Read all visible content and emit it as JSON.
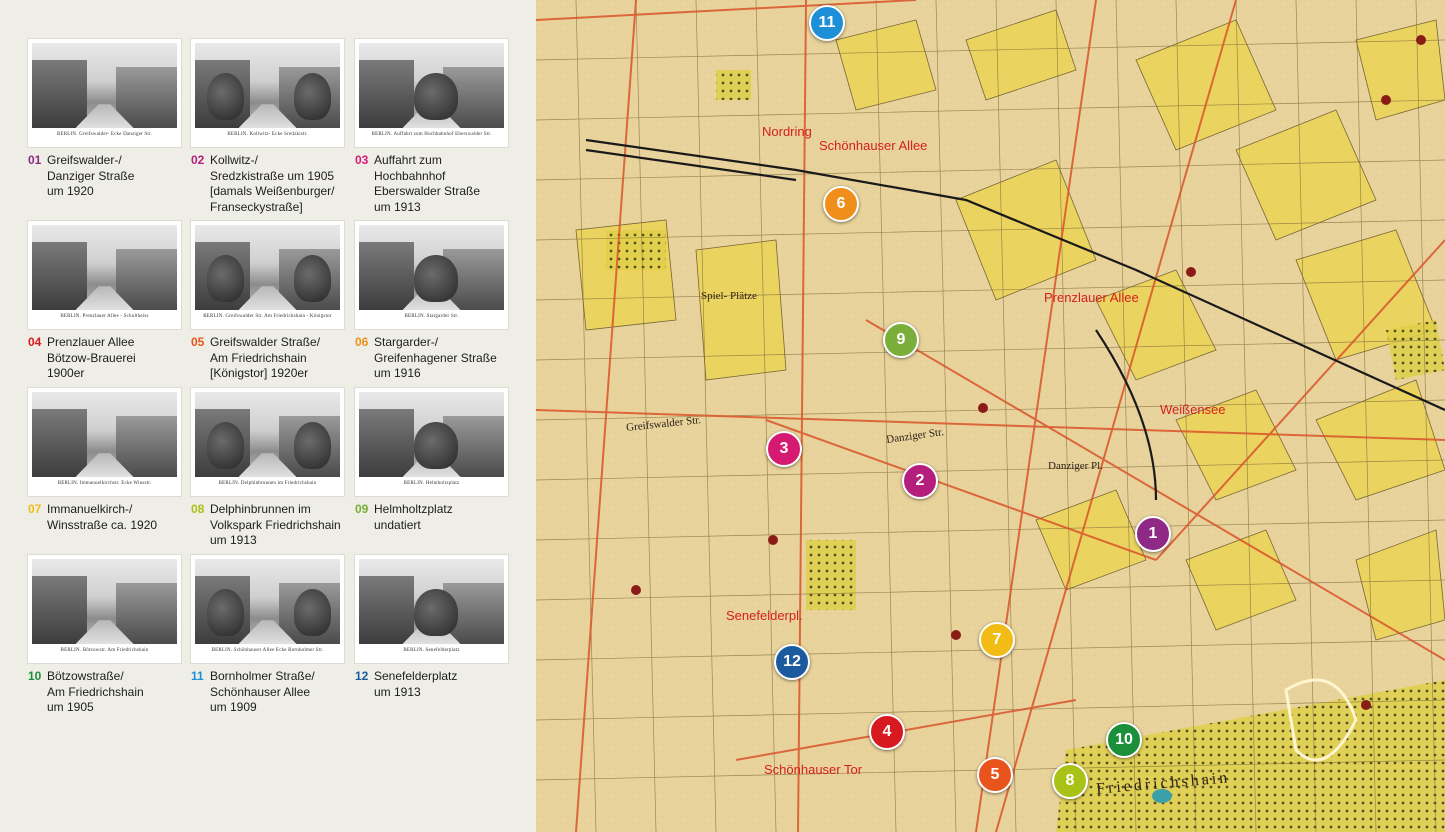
{
  "colors": {
    "c01": "#8e2a86",
    "c02": "#b41f7e",
    "c03": "#d61a72",
    "c04": "#d71920",
    "c05": "#e8541b",
    "c06": "#ef8e1a",
    "c07": "#f2bc14",
    "c08": "#a8c218",
    "c09": "#7aae3a",
    "c10": "#1c8f3a",
    "c11": "#1d8fd6",
    "c12": "#1c5aa0"
  },
  "photos": [
    {
      "num": "01",
      "color": "#8e2a86",
      "text": "Greifswalder-/\nDanziger Straße\num 1920",
      "caption": "BERLIN. Greifswalder- Ecke Danziger Str."
    },
    {
      "num": "02",
      "color": "#b41f7e",
      "text": "Kollwitz-/\nSredzkistraße um 1905\n[damals Weißenburger/\nFranseckystraße]",
      "caption": "BERLIN. Kollwitz- Ecke Sredzkistr."
    },
    {
      "num": "03",
      "color": "#d61a72",
      "text": "Auffahrt zum\nHochbahnhof\nEberswalder Straße\num 1913",
      "caption": "BERLIN. Auffahrt zum Hochbahnhof Eberswalder Str."
    },
    {
      "num": "04",
      "color": "#d71920",
      "text": "Prenzlauer Allee\nBötzow-Brauerei\n1900er",
      "caption": "BERLIN. Prenzlauer Allee - Schultheiss"
    },
    {
      "num": "05",
      "color": "#e8541b",
      "text": "Greifswalder Straße/\nAm Friedrichshain\n[Königstor] 1920er",
      "caption": "BERLIN. Greifswalder Str. Am Friedrichshain - Königstor"
    },
    {
      "num": "06",
      "color": "#ef8e1a",
      "text": "Stargarder-/\nGreifenhagener Straße\num 1916",
      "caption": "BERLIN. Stargarder Str."
    },
    {
      "num": "07",
      "color": "#f2bc14",
      "text": "Immanuelkirch-/\nWinsstraße ca. 1920",
      "caption": "BERLIN. Immanuelkirchstr. Ecke Winsstr."
    },
    {
      "num": "08",
      "color": "#a8c218",
      "text": "Delphinbrunnen im\nVolkspark Friedrichshain\num 1913",
      "caption": "BERLIN. Delphinbrunnen im Friedrichshain"
    },
    {
      "num": "09",
      "color": "#7aae3a",
      "text": "Helmholtzplatz\nundatiert",
      "caption": "BERLIN. Helmholtzplatz"
    },
    {
      "num": "10",
      "color": "#1c8f3a",
      "text": "Bötzowstraße/\nAm Friedrichshain\num 1905",
      "caption": "BERLIN. Bötzowstr. Am Friedrichshain"
    },
    {
      "num": "11",
      "color": "#1d8fd6",
      "text": "Bornholmer Straße/\nSchönhauser Allee\num 1909",
      "caption": "BERLIN. Schönhauser Allee Ecke Bornholmer Str."
    },
    {
      "num": "12",
      "color": "#1c5aa0",
      "text": "Senefelderplatz\num 1913",
      "caption": "BERLIN. Senefelderplatz"
    }
  ],
  "markers": [
    {
      "num": "1",
      "color": "#8e2a86"
    },
    {
      "num": "2",
      "color": "#b41f7e"
    },
    {
      "num": "3",
      "color": "#d61a72"
    },
    {
      "num": "4",
      "color": "#d71920"
    },
    {
      "num": "5",
      "color": "#e8541b"
    },
    {
      "num": "6",
      "color": "#ef8e1a"
    },
    {
      "num": "7",
      "color": "#f2bc14"
    },
    {
      "num": "8",
      "color": "#a8c218"
    },
    {
      "num": "9",
      "color": "#7aae3a"
    },
    {
      "num": "10",
      "color": "#1c8f3a"
    },
    {
      "num": "11",
      "color": "#1d8fd6"
    },
    {
      "num": "12",
      "color": "#1c5aa0"
    }
  ],
  "map_labels": {
    "schoenhauser_allee": "Schönhauser Allee",
    "nordring": "Nordring",
    "prenzlauer_allee": "Prenzlauer Allee",
    "weissensee": "Weißensee",
    "danziger_str": "Danziger Str.",
    "spielplaetze": "Spiel- Plätze",
    "friedrichshain": "Friedrichshain",
    "schoenhauser_tor": "Schönhauser Tor",
    "greifswalder_str": "Greifswalder Str.",
    "senefelderpl": "Senefelderpl.",
    "danziger_platz": "Danziger Pl."
  }
}
